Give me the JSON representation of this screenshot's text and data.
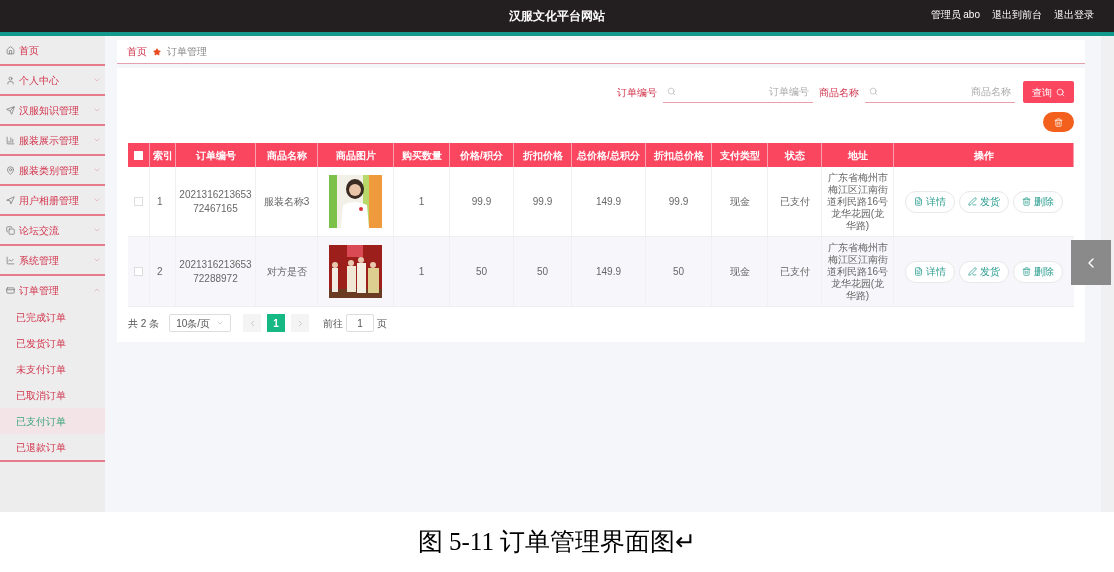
{
  "header": {
    "title": "汉服文化平台网站",
    "user": "管理员 abo",
    "links": [
      "退出到前台",
      "退出登录"
    ]
  },
  "sidebar": {
    "items": [
      {
        "label": "首页"
      },
      {
        "label": "个人中心",
        "expandable": true,
        "expanded": false
      },
      {
        "label": "汉服知识管理",
        "expandable": true,
        "expanded": false
      },
      {
        "label": "服装展示管理",
        "expandable": true,
        "expanded": false
      },
      {
        "label": "服装类别管理",
        "expandable": true,
        "expanded": false
      },
      {
        "label": "用户相册管理",
        "expandable": true,
        "expanded": false
      },
      {
        "label": "论坛交流",
        "expandable": true,
        "expanded": false
      },
      {
        "label": "系统管理",
        "expandable": true,
        "expanded": false
      },
      {
        "label": "订单管理",
        "expandable": true,
        "expanded": true,
        "children": [
          {
            "label": "已完成订单",
            "selected": false
          },
          {
            "label": "已发货订单",
            "selected": false
          },
          {
            "label": "未支付订单",
            "selected": false
          },
          {
            "label": "已取消订单",
            "selected": false
          },
          {
            "label": "已支付订单",
            "selected": true
          },
          {
            "label": "已退款订单",
            "selected": false
          }
        ]
      }
    ]
  },
  "breadcrumb": [
    "首页",
    "订单管理"
  ],
  "search": {
    "fields": [
      {
        "label": "订单编号",
        "placeholder": "订单编号"
      },
      {
        "label": "商品名称",
        "placeholder": "商品名称"
      }
    ],
    "button": "查询"
  },
  "table": {
    "columns": [
      "索引",
      "订单编号",
      "商品名称",
      "商品图片",
      "购买数量",
      "价格/积分",
      "折扣价格",
      "总价格/总积分",
      "折扣总价格",
      "支付类型",
      "状态",
      "地址",
      "操作"
    ],
    "all_checked": false,
    "rows": [
      {
        "checked": false,
        "cells": [
          "1",
          "202131621365372467165",
          "服装名称3",
          "",
          "1",
          "99.9",
          "99.9",
          "149.9",
          "99.9",
          "现金",
          "已支付",
          "广东省梅州市梅江区江南街道利民路16号龙华花园(龙华路)"
        ],
        "actions": [
          "详情",
          "发货",
          "删除"
        ]
      },
      {
        "checked": false,
        "cells": [
          "2",
          "202131621365372288972",
          "对方是否",
          "",
          "1",
          "50",
          "50",
          "149.9",
          "50",
          "现金",
          "已支付",
          "广东省梅州市梅江区江南街道利民路16号龙华花园(龙华路)"
        ],
        "actions": [
          "详情",
          "发货",
          "删除"
        ]
      }
    ]
  },
  "pagination": {
    "total": "共 2 条",
    "page_size": "10条/页",
    "pages": [
      {
        "label": "1",
        "selected": true
      }
    ],
    "goto_label": "前往",
    "goto_value": "1",
    "goto_unit": "页"
  },
  "caption": "图 5-11 订单管理界面图↵"
}
